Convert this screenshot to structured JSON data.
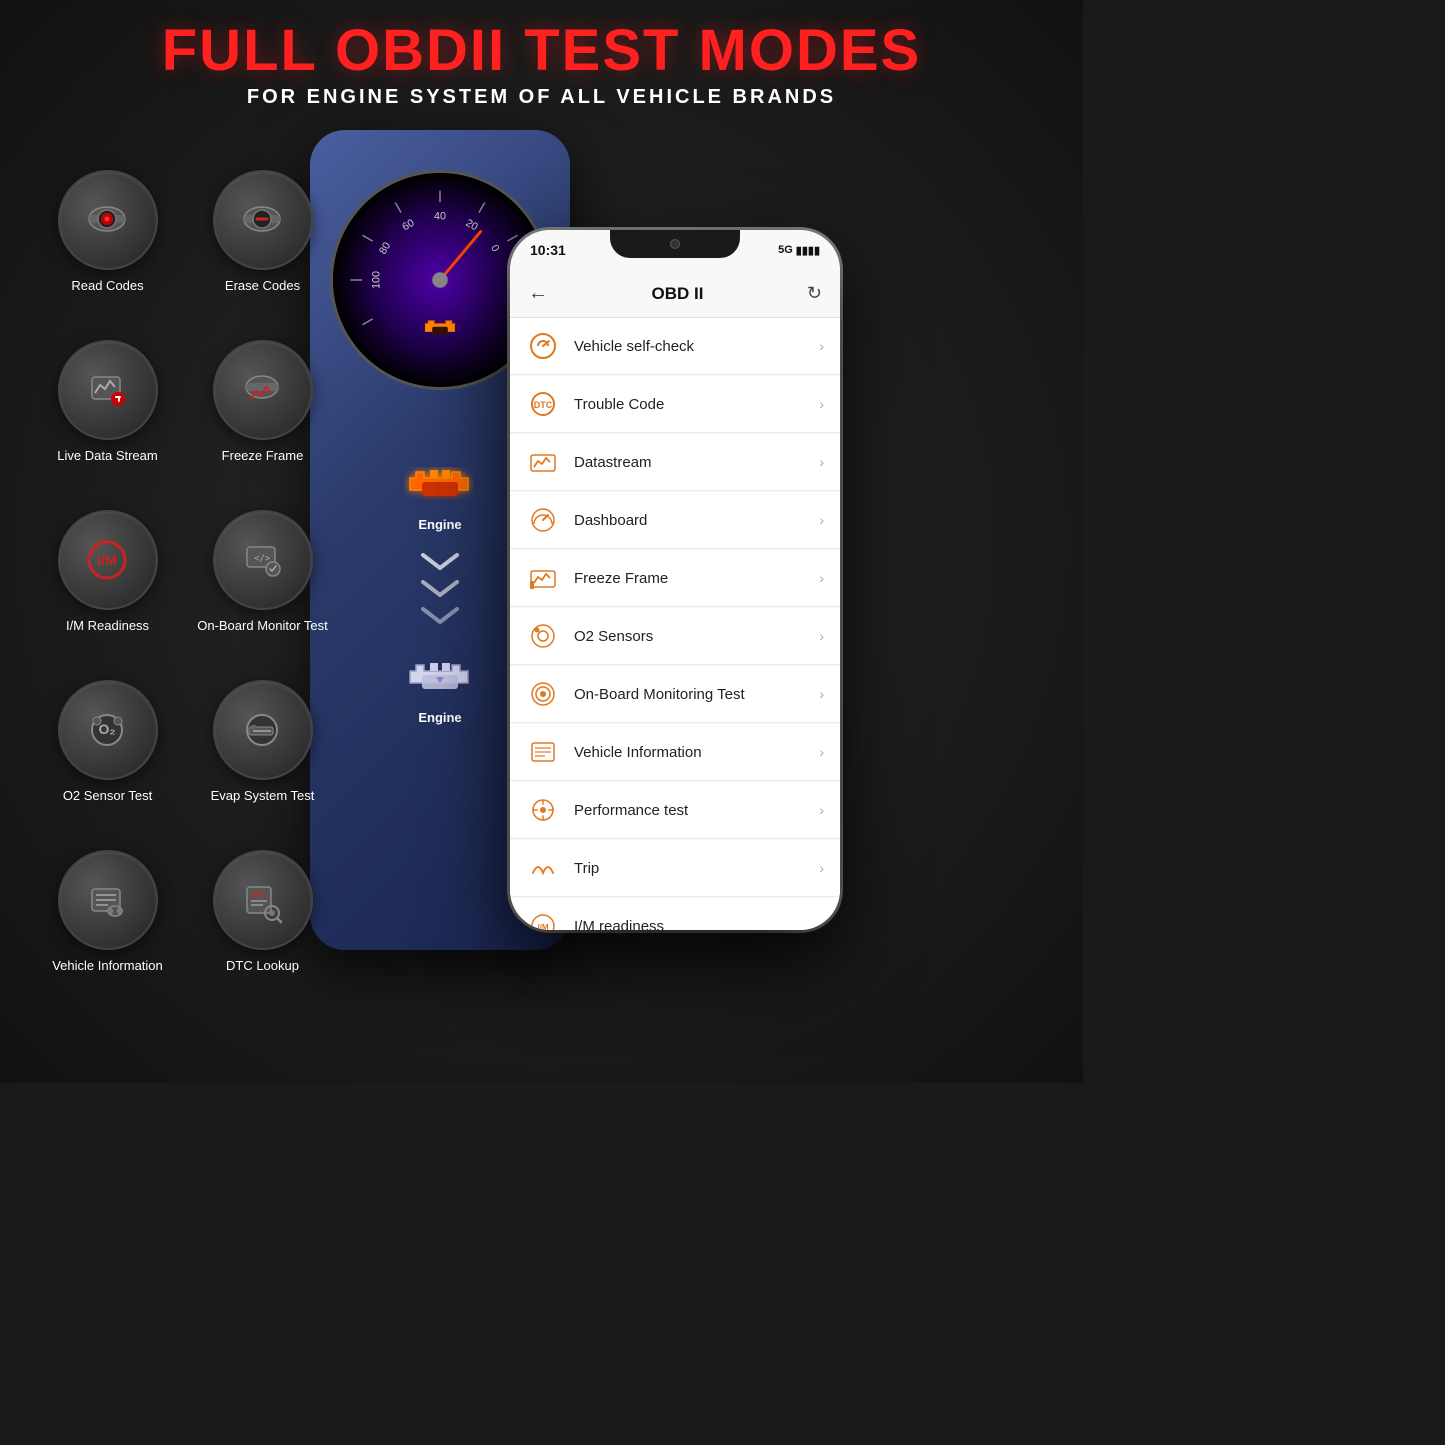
{
  "header": {
    "title": "FULL OBDII TEST MODES",
    "subtitle": "FOR ENGINE SYSTEM OF ALL VEHICLE BRANDS"
  },
  "features": [
    {
      "id": "read-codes",
      "label": "Read Codes",
      "icon": "car-scan-red"
    },
    {
      "id": "erase-codes",
      "label": "Erase Codes",
      "icon": "car-erase-red"
    },
    {
      "id": "live-data-stream",
      "label": "Live Data Stream",
      "icon": "chart-record-red"
    },
    {
      "id": "freeze-frame",
      "label": "Freeze Frame",
      "icon": "car-graph-red"
    },
    {
      "id": "im-readiness",
      "label": "I/M Readiness",
      "icon": "im-circle"
    },
    {
      "id": "on-board-monitor",
      "label": "On-Board Monitor Test",
      "icon": "code-gear"
    },
    {
      "id": "o2-sensor-test",
      "label": "O2 Sensor Test",
      "icon": "o2-circle"
    },
    {
      "id": "evap-system-test",
      "label": "Evap System Test",
      "icon": "evap-gauge"
    },
    {
      "id": "vehicle-info",
      "label": "Vehicle Information",
      "icon": "car-id"
    },
    {
      "id": "dtc-lookup",
      "label": "DTC Lookup",
      "icon": "dtc-search"
    }
  ],
  "phone": {
    "status": {
      "time": "10:31",
      "signal": "5G",
      "battery": "▮▮▮▮"
    },
    "nav": {
      "title": "OBD II",
      "back": "←",
      "refresh": "↻"
    },
    "menu_items": [
      {
        "id": "vehicle-self-check",
        "label": "Vehicle self-check",
        "icon": "🔄"
      },
      {
        "id": "trouble-code",
        "label": "Trouble Code",
        "icon": "⊙"
      },
      {
        "id": "datastream",
        "label": "Datastream",
        "icon": "📊"
      },
      {
        "id": "dashboard",
        "label": "Dashboard",
        "icon": "🎛"
      },
      {
        "id": "freeze-frame",
        "label": "Freeze Frame",
        "icon": "📈"
      },
      {
        "id": "o2-sensors",
        "label": "O2 Sensors",
        "icon": "⊙"
      },
      {
        "id": "on-board-monitoring",
        "label": "On-Board Monitoring Test",
        "icon": "●"
      },
      {
        "id": "vehicle-information",
        "label": "Vehicle Information",
        "icon": "🗒"
      },
      {
        "id": "performance-test",
        "label": "Performance test",
        "icon": "⚙"
      },
      {
        "id": "trip",
        "label": "Trip",
        "icon": "🛣"
      },
      {
        "id": "im-readiness",
        "label": "I/M readiness",
        "icon": "I/M"
      }
    ]
  },
  "center": {
    "engine_label1": "Engine",
    "engine_label2": "Engine"
  }
}
